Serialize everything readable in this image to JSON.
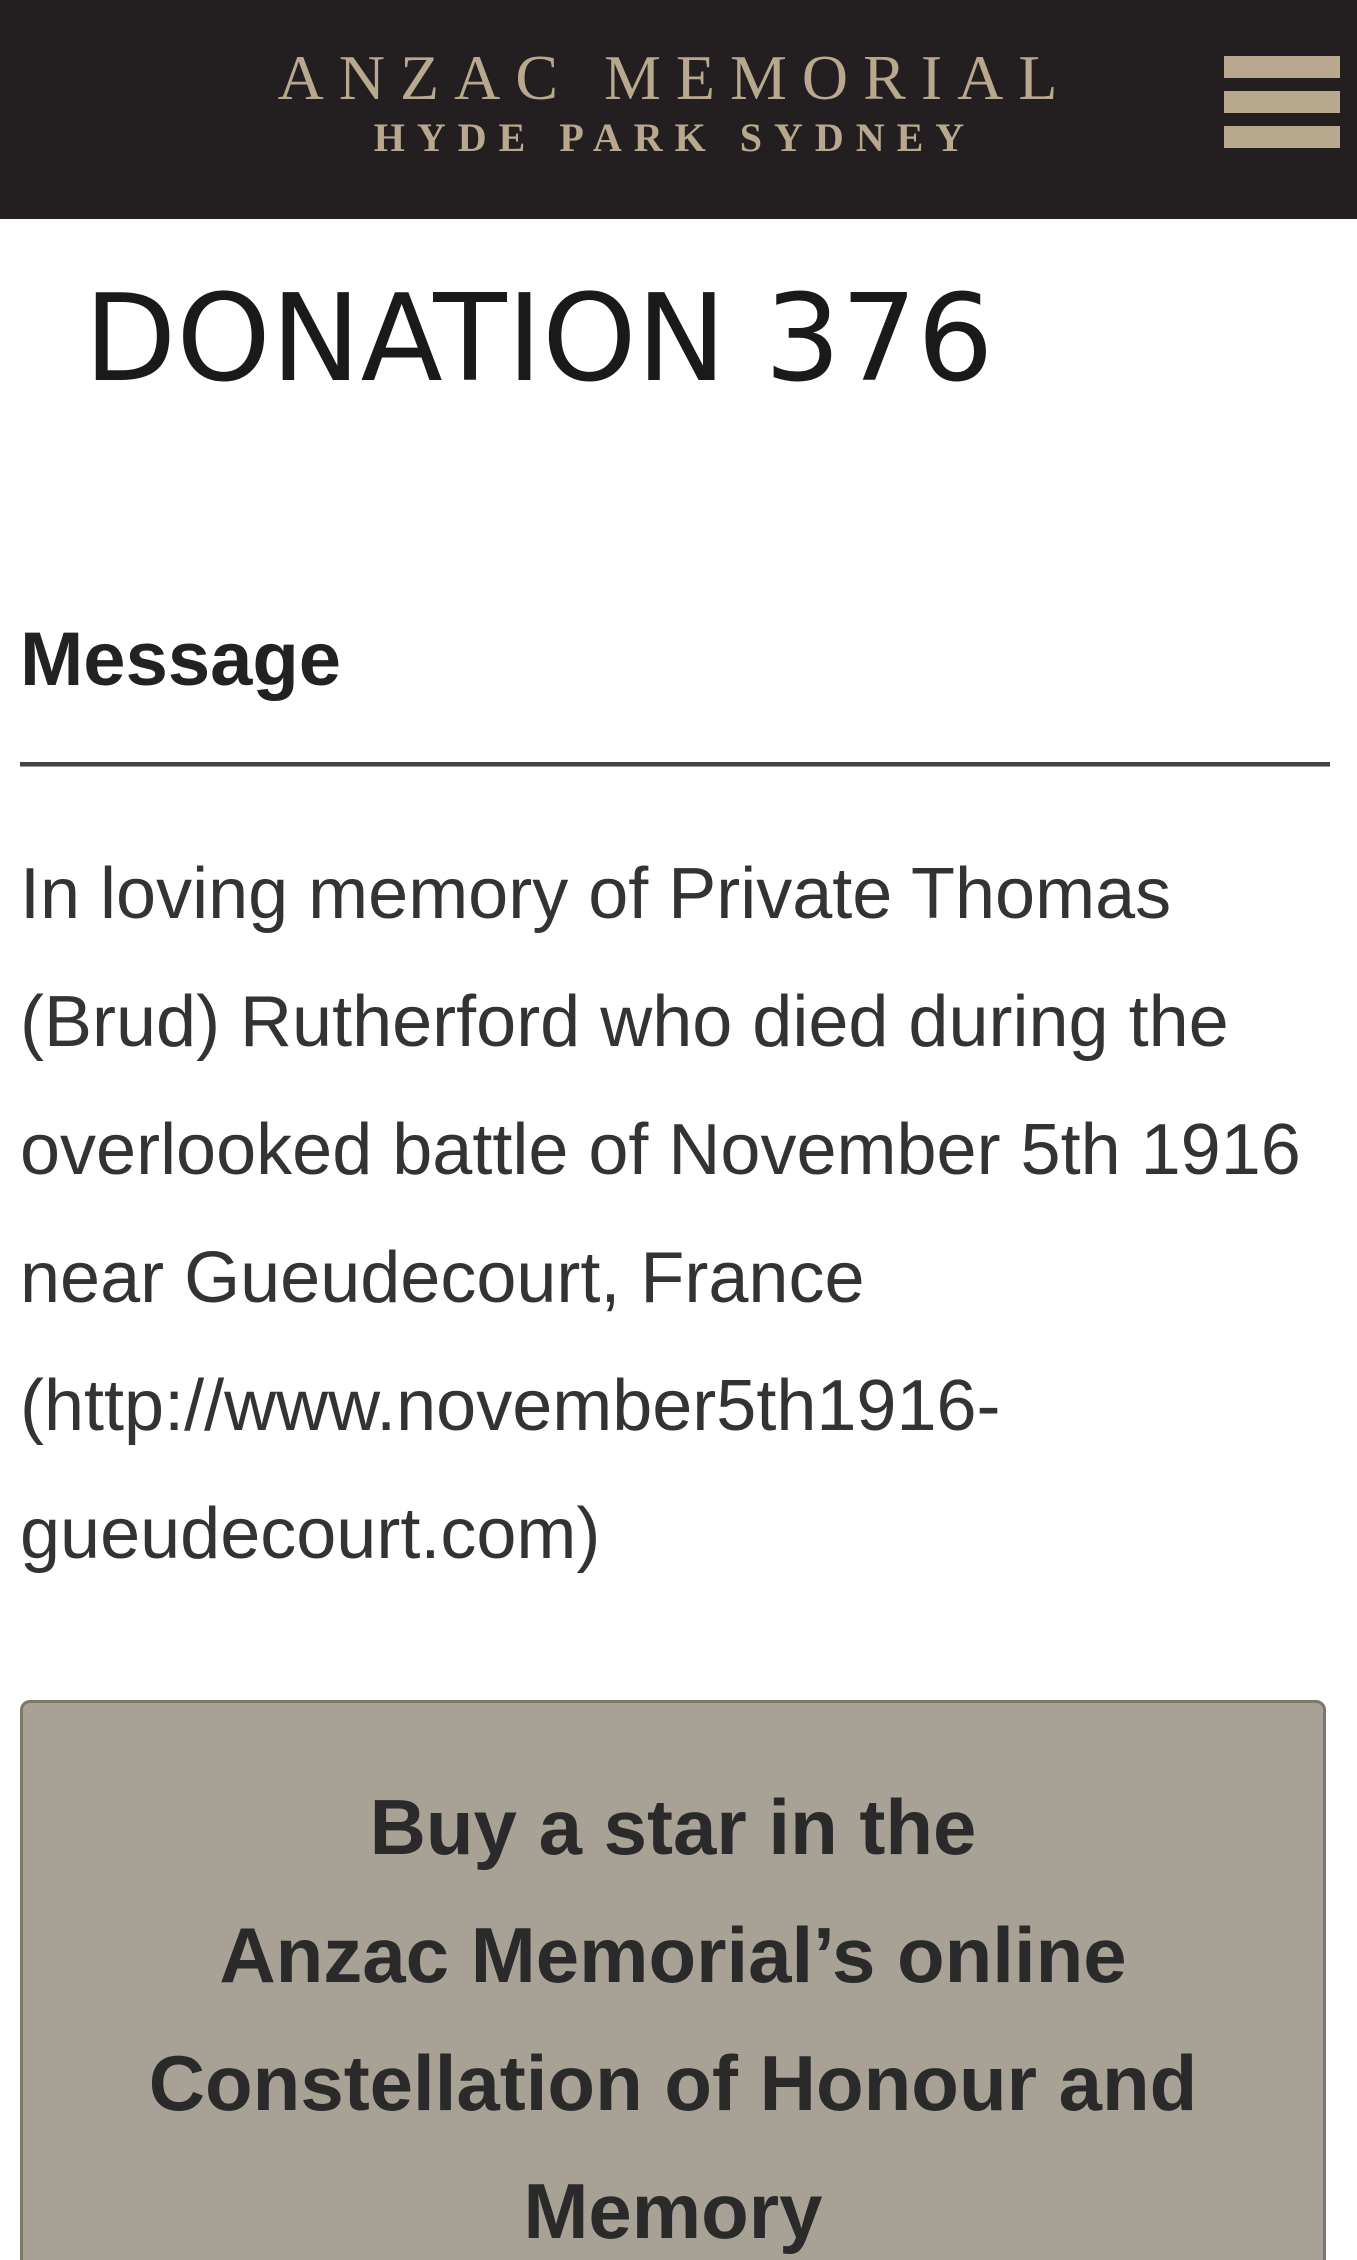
{
  "header": {
    "logo_line1": "ANZAC MEMORIAL",
    "logo_line2": "HYDE PARK  SYDNEY",
    "menu_icon": "hamburger-menu-icon",
    "background_color": "#231f20",
    "accent_color": "#b8a88e"
  },
  "page": {
    "title": "DONATION 376"
  },
  "message": {
    "heading": "Message",
    "body": "In loving memory of Private Thomas (Brud) Rutherford who died during the overlooked battle of November 5th 1916 near Gueudecourt, France (http://www.november5th1916-gueudecourt.com)"
  },
  "cta": {
    "line1": "Buy a star in the",
    "line2": "Anzac Memorial’s online",
    "line3": "Constellation of Honour and",
    "line4": "Memory",
    "background_color": "#a8a196"
  }
}
